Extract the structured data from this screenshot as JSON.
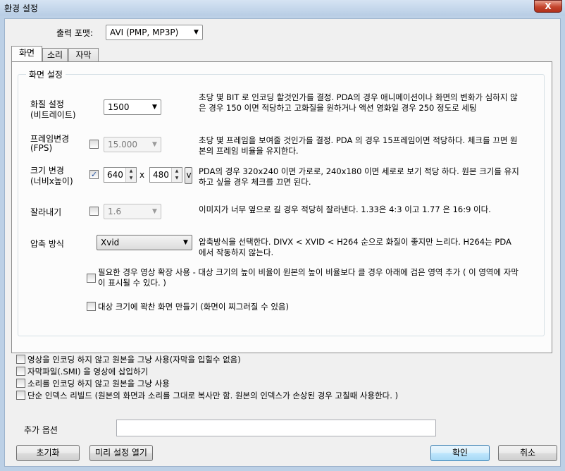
{
  "window": {
    "title": "환경 설정",
    "close_label": "X"
  },
  "output_format": {
    "label": "출력 포맷:",
    "value": "AVI (PMP, MP3P)"
  },
  "tabs": [
    {
      "label": "화면"
    },
    {
      "label": "소리"
    },
    {
      "label": "자막"
    }
  ],
  "screen": {
    "group_label": "화면 설정",
    "quality": {
      "label_line1": "화질 설정",
      "label_line2": "(비트레이트)",
      "value": "1500",
      "desc": "초당 몇 BIT 로 인코딩 할것인가를 결정. PDA의 경우 애니메이션이나 화면의 변화가 심하지 않은 경우 150 이면 적당하고 고화질을 원하거나 액션 영화일 경우  250 정도로 세팅"
    },
    "fps": {
      "label_line1": "프레임변경",
      "label_line2": "(FPS)",
      "checked": false,
      "value": "15.000",
      "desc": "초당 몇 프레임을 보여줄 것인가를 결정. PDA 의 경우 15프레임이면 적당하다. 체크를 끄면 원본의 프레임 비율을 유지한다."
    },
    "size": {
      "label_line1": "크기 변경",
      "label_line2": "(너비x높이)",
      "checked": true,
      "width": "640",
      "times": "x",
      "height": "480",
      "preset_btn": "v",
      "desc": "PDA의 경우 320x240 이면 가로로, 240x180 이면 세로로 보기 적당 하다. 원본 크기를 유지하고 싶을 경우 체크를 끄면 된다."
    },
    "crop": {
      "label": "잘라내기",
      "checked": false,
      "value": "1.6",
      "desc": "이미지가 너무 옆으로 길 경우 적당히 잘라낸다. 1.33은 4:3 이고 1.77 은 16:9 이다."
    },
    "codec": {
      "label": "압축 방식",
      "value": "Xvid",
      "desc": "압축방식을 선택한다.  DIVX < XVID < H264 순으로 화질이 좋지만 느리다. H264는 PDA 에서 작동하지 않는다."
    },
    "letterbox": {
      "checked": false,
      "label": "필요한 경우 영상 확장 사용 - 대상 크기의 높이 비율이 원본의 높이 비율보다 클 경우 아래에 검은  영역 추가 ( 이 영역에 자막이 표시될 수 있다. )"
    },
    "stretch": {
      "checked": false,
      "label": "대상 크기에 꽉찬 화면 만들기 (화면이 찌그러질 수 있음)"
    }
  },
  "options": [
    {
      "checked": false,
      "label": "영상을 인코딩 하지 않고 원본을 그냥 사용(자막을 입힐수 없음)"
    },
    {
      "checked": false,
      "label": "자막파일(.SMI) 을 영상에 삽입하기"
    },
    {
      "checked": false,
      "label": "소리를 인코딩 하지 않고 원본을 그냥 사용"
    },
    {
      "checked": false,
      "label": "단순 인덱스 리빌드 (원본의 화면과 소리를 그대로 복사만 함. 원본의 인덱스가 손상된 경우 고칠때 사용한다. )"
    }
  ],
  "extra": {
    "label": "추가 옵션",
    "value": ""
  },
  "buttons": {
    "reset": "초기화",
    "presets": "미리 설정 열기",
    "ok": "확인",
    "cancel": "취소"
  }
}
